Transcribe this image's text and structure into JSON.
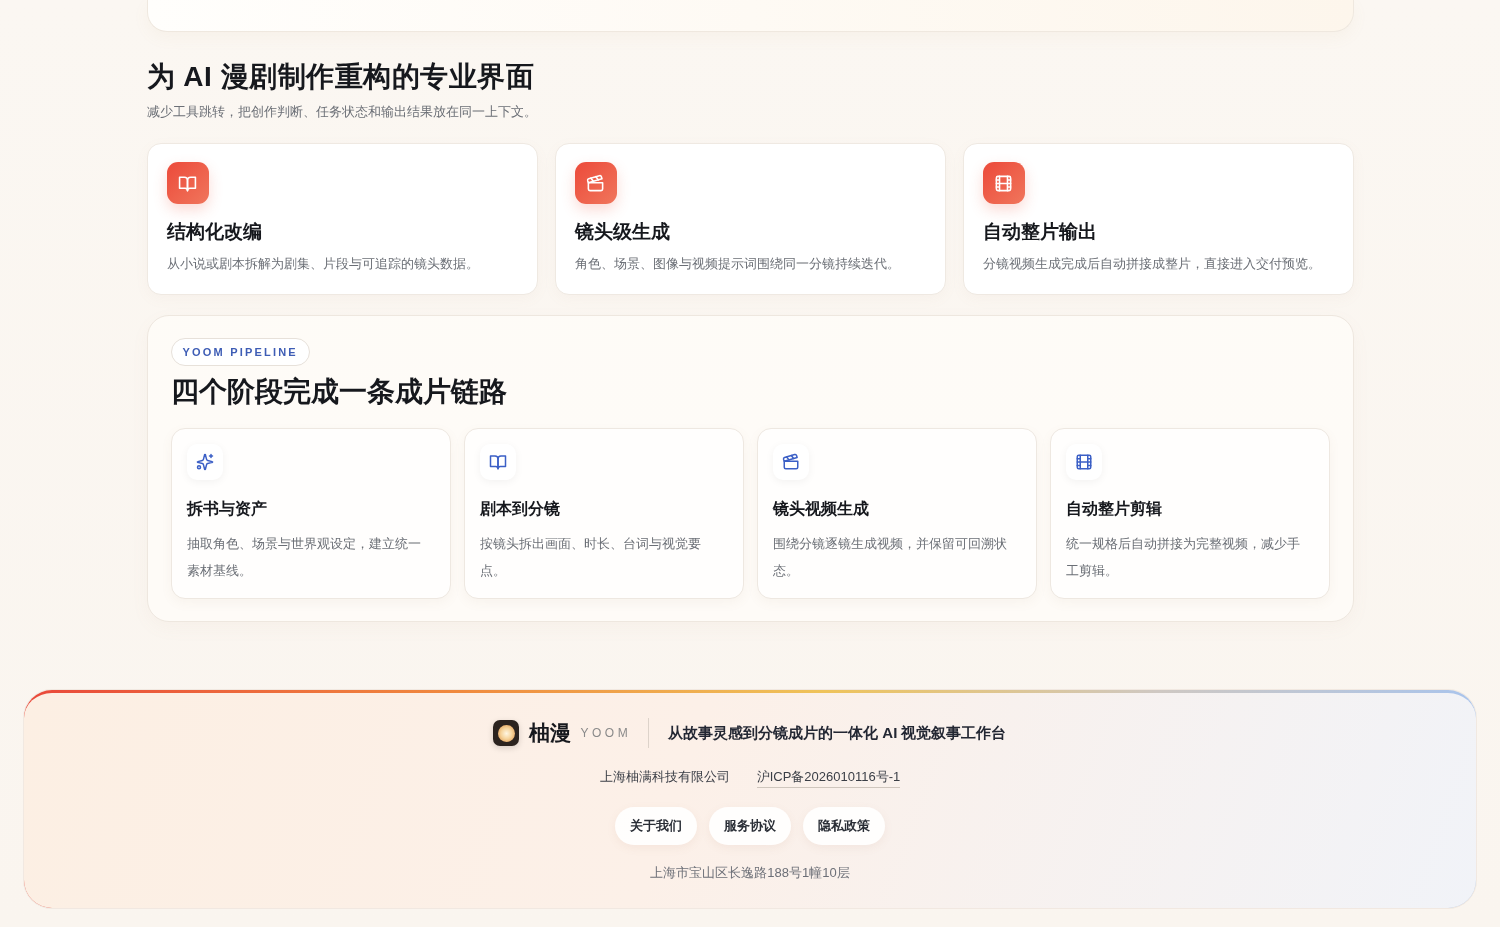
{
  "intro": {
    "title": "为 AI 漫剧制作重构的专业界面",
    "subtitle": "减少工具跳转，把创作判断、任务状态和输出结果放在同一上下文。"
  },
  "features": [
    {
      "title": "结构化改编",
      "description": "从小说或剧本拆解为剧集、片段与可追踪的镜头数据。"
    },
    {
      "title": "镜头级生成",
      "description": "角色、场景、图像与视频提示词围绕同一分镜持续迭代。"
    },
    {
      "title": "自动整片输出",
      "description": "分镜视频生成完成后自动拼接成整片，直接进入交付预览。"
    }
  ],
  "pipeline": {
    "tag": "YOOM PIPELINE",
    "title": "四个阶段完成一条成片链路",
    "stages": [
      {
        "title": "拆书与资产",
        "description": "抽取角色、场景与世界观设定，建立统一素材基线。"
      },
      {
        "title": "剧本到分镜",
        "description": "按镜头拆出画面、时长、台词与视觉要点。"
      },
      {
        "title": "镜头视频生成",
        "description": "围绕分镜逐镜生成视频，并保留可回溯状态。"
      },
      {
        "title": "自动整片剪辑",
        "description": "统一规格后自动拼接为完整视频，减少手工剪辑。"
      }
    ]
  },
  "footer": {
    "brand": "柚漫",
    "brand_latin": "YOOM",
    "tagline": "从故事灵感到分镜成片的一体化 AI 视觉叙事工作台",
    "company": "上海柚满科技有限公司",
    "icp": "沪ICP备2026010116号-1",
    "links": [
      "关于我们",
      "服务协议",
      "隐私政策"
    ],
    "address": "上海市宝山区长逸路188号1幢10层"
  }
}
